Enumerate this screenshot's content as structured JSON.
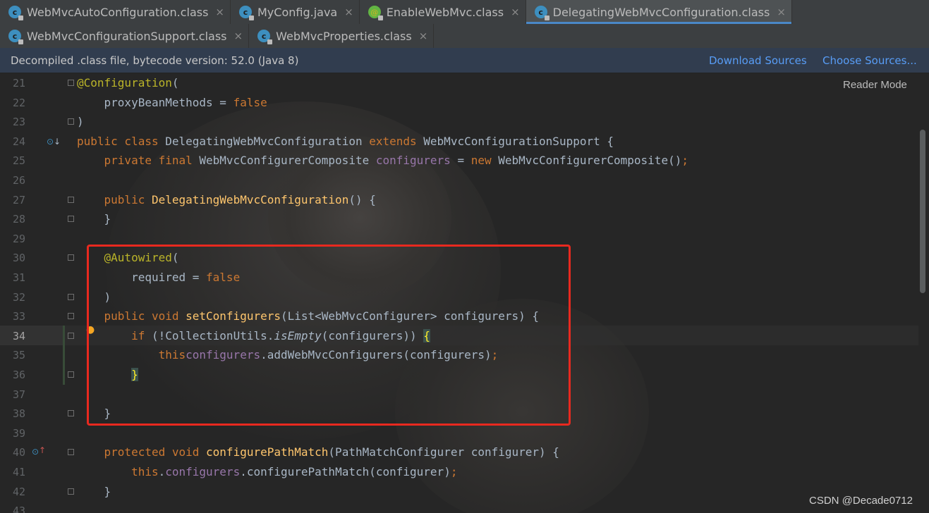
{
  "tabs": {
    "row1": [
      {
        "label": "WebMvcAutoConfiguration.class",
        "icon": "class-icon"
      },
      {
        "label": "MyConfig.java",
        "icon": "class-icon"
      },
      {
        "label": "EnableWebMvc.class",
        "icon": "annotation-icon"
      },
      {
        "label": "DelegatingWebMvcConfiguration.class",
        "icon": "class-icon",
        "active": true
      }
    ],
    "row2": [
      {
        "label": "WebMvcConfigurationSupport.class",
        "icon": "class-icon"
      },
      {
        "label": "WebMvcProperties.class",
        "icon": "class-icon"
      }
    ],
    "close_glyph": "×",
    "class_glyph": "c",
    "annotation_glyph": "@"
  },
  "banner": {
    "text": "Decompiled .class file, bytecode version: 52.0 (Java 8)",
    "download_sources": "Download Sources",
    "choose_sources": "Choose Sources..."
  },
  "editor": {
    "reader_mode": "Reader Mode",
    "current_line": 34,
    "line_numbers": [
      "21",
      "22",
      "23",
      "24",
      "25",
      "26",
      "27",
      "28",
      "29",
      "30",
      "31",
      "32",
      "33",
      "34",
      "35",
      "36",
      "37",
      "38",
      "39",
      "40",
      "41",
      "42",
      "43"
    ],
    "lines": [
      {
        "n": "21",
        "tokens": [
          [
            "ann",
            "@Configuration"
          ],
          [
            "",
            "("
          ]
        ]
      },
      {
        "n": "22",
        "tokens": [
          [
            "",
            "    proxyBeanMethods = "
          ],
          [
            "kw",
            "false"
          ]
        ]
      },
      {
        "n": "23",
        "tokens": [
          [
            "",
            ")"
          ]
        ]
      },
      {
        "n": "24",
        "tokens": [
          [
            "kw",
            "public class "
          ],
          [
            "",
            "DelegatingWebMvcConfiguration "
          ],
          [
            "kw",
            "extends "
          ],
          [
            "",
            "WebMvcConfigurationSupport {"
          ]
        ]
      },
      {
        "n": "25",
        "tokens": [
          [
            "kw",
            "    private final "
          ],
          [
            "",
            "WebMvcConfigurerComposite "
          ],
          [
            "fld",
            "configurers"
          ],
          [
            "",
            " = "
          ],
          [
            "kw",
            "new "
          ],
          [
            "",
            "WebMvcConfigurerComposite()"
          ],
          [
            "kw",
            ";"
          ]
        ]
      },
      {
        "n": "26",
        "tokens": []
      },
      {
        "n": "27",
        "tokens": [
          [
            "kw",
            "    public "
          ],
          [
            "fn",
            "DelegatingWebMvcConfiguration"
          ],
          [
            "",
            "() {"
          ]
        ]
      },
      {
        "n": "28",
        "tokens": [
          [
            "",
            "    }"
          ]
        ]
      },
      {
        "n": "29",
        "tokens": []
      },
      {
        "n": "30",
        "tokens": [
          [
            "ann",
            "    @Autowired"
          ],
          [
            "",
            "("
          ]
        ]
      },
      {
        "n": "31",
        "tokens": [
          [
            "",
            "        required = "
          ],
          [
            "kw",
            "false"
          ]
        ]
      },
      {
        "n": "32",
        "tokens": [
          [
            "",
            "    )"
          ]
        ]
      },
      {
        "n": "33",
        "tokens": [
          [
            "kw",
            "    public void "
          ],
          [
            "fn",
            "setConfigurers"
          ],
          [
            "",
            "(List<WebMvcConfigurer> configurers) {"
          ]
        ]
      },
      {
        "n": "34",
        "tokens": [
          [
            "kw",
            "        if "
          ],
          [
            "",
            "(!CollectionUtils."
          ],
          [
            "it",
            "isEmpty"
          ],
          [
            "",
            "(configurers)) "
          ],
          [
            "brace",
            "{"
          ]
        ]
      },
      {
        "n": "35",
        "tokens": [
          [
            "kw",
            "            this"
          ],
          [
            ".",
            ""
          ],
          [
            "fld",
            "configurers"
          ],
          [
            "",
            ".addWebMvcConfigurers(configurers)"
          ],
          [
            "kw",
            ";"
          ]
        ]
      },
      {
        "n": "36",
        "tokens": [
          [
            "",
            "        "
          ],
          [
            "brace",
            "}"
          ]
        ]
      },
      {
        "n": "37",
        "tokens": []
      },
      {
        "n": "38",
        "tokens": [
          [
            "",
            "    }"
          ]
        ]
      },
      {
        "n": "39",
        "tokens": []
      },
      {
        "n": "40",
        "tokens": [
          [
            "kw",
            "    protected void "
          ],
          [
            "fn",
            "configurePathMatch"
          ],
          [
            "",
            "(PathMatchConfigurer configurer) {"
          ]
        ]
      },
      {
        "n": "41",
        "tokens": [
          [
            "kw",
            "        this"
          ],
          [
            "",
            "."
          ],
          [
            "fld",
            "configurers"
          ],
          [
            "",
            ".configurePathMatch(configurer)"
          ],
          [
            "kw",
            ";"
          ]
        ]
      },
      {
        "n": "42",
        "tokens": [
          [
            "",
            "    }"
          ]
        ]
      },
      {
        "n": "43",
        "tokens": []
      }
    ]
  },
  "watermark": "CSDN @Decade0712"
}
